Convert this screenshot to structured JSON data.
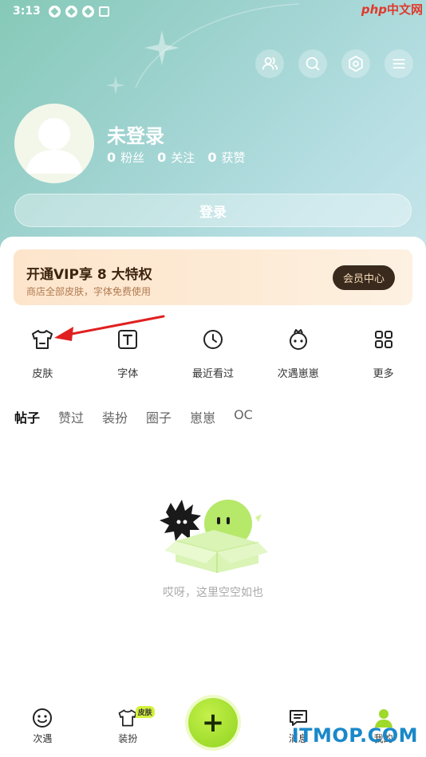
{
  "status_bar": {
    "time": "3:13"
  },
  "watermark_top": {
    "php": "php",
    "cn": "中文网"
  },
  "profile": {
    "name": "未登录",
    "stats": [
      {
        "value": "0",
        "label": "粉丝"
      },
      {
        "value": "0",
        "label": "关注"
      },
      {
        "value": "0",
        "label": "获赞"
      }
    ],
    "login_label": "登录"
  },
  "top_icons": [
    "user-friends-icon",
    "search-icon",
    "settings-icon",
    "menu-icon"
  ],
  "vip": {
    "title": "开通VIP享 8 大特权",
    "subtitle": "商店全部皮肤，字体免费使用",
    "button": "会员中心"
  },
  "shortcuts": [
    {
      "label": "皮肤",
      "icon": "tshirt-icon"
    },
    {
      "label": "字体",
      "icon": "font-icon"
    },
    {
      "label": "最近看过",
      "icon": "clock-icon"
    },
    {
      "label": "次遇崽崽",
      "icon": "pet-icon"
    },
    {
      "label": "更多",
      "icon": "grid-icon"
    }
  ],
  "tabs": [
    "帖子",
    "赞过",
    "装扮",
    "圈子",
    "崽崽",
    "OC"
  ],
  "empty_text": "哎呀，这里空空如也",
  "bottom_nav": [
    {
      "label": "次遇",
      "icon": "smile-icon"
    },
    {
      "label": "装扮",
      "icon": "tshirt-icon",
      "badge": "皮肤"
    },
    {
      "label": "消息",
      "icon": "message-icon"
    },
    {
      "label": "我的",
      "icon": "profile-icon"
    }
  ],
  "fab": "+",
  "watermark_bottom": "ITMOP.COM",
  "colors": {
    "accent": "#9fd92a",
    "header": "#9fd3d0",
    "arrow": "#e02020"
  }
}
